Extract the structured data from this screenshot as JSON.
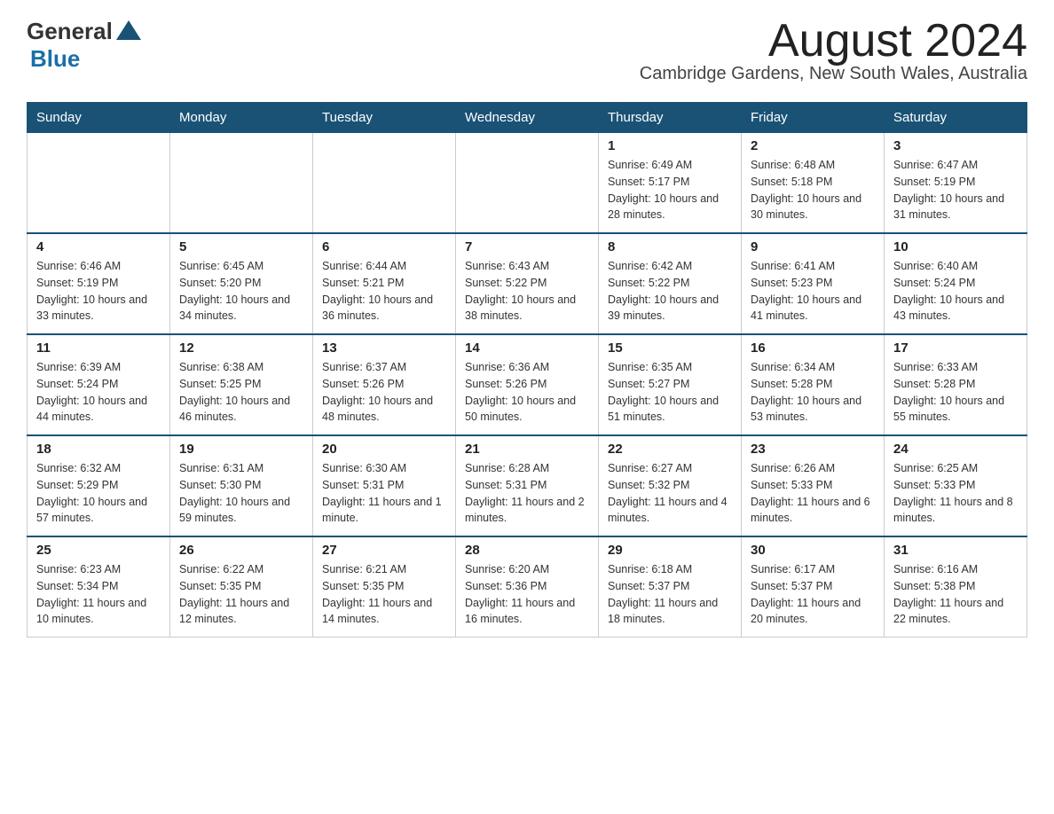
{
  "logo": {
    "general": "General",
    "blue": "Blue"
  },
  "title": "August 2024",
  "subtitle": "Cambridge Gardens, New South Wales, Australia",
  "days_of_week": [
    "Sunday",
    "Monday",
    "Tuesday",
    "Wednesday",
    "Thursday",
    "Friday",
    "Saturday"
  ],
  "weeks": [
    [
      {
        "day": "",
        "info": ""
      },
      {
        "day": "",
        "info": ""
      },
      {
        "day": "",
        "info": ""
      },
      {
        "day": "",
        "info": ""
      },
      {
        "day": "1",
        "info": "Sunrise: 6:49 AM\nSunset: 5:17 PM\nDaylight: 10 hours and 28 minutes."
      },
      {
        "day": "2",
        "info": "Sunrise: 6:48 AM\nSunset: 5:18 PM\nDaylight: 10 hours and 30 minutes."
      },
      {
        "day": "3",
        "info": "Sunrise: 6:47 AM\nSunset: 5:19 PM\nDaylight: 10 hours and 31 minutes."
      }
    ],
    [
      {
        "day": "4",
        "info": "Sunrise: 6:46 AM\nSunset: 5:19 PM\nDaylight: 10 hours and 33 minutes."
      },
      {
        "day": "5",
        "info": "Sunrise: 6:45 AM\nSunset: 5:20 PM\nDaylight: 10 hours and 34 minutes."
      },
      {
        "day": "6",
        "info": "Sunrise: 6:44 AM\nSunset: 5:21 PM\nDaylight: 10 hours and 36 minutes."
      },
      {
        "day": "7",
        "info": "Sunrise: 6:43 AM\nSunset: 5:22 PM\nDaylight: 10 hours and 38 minutes."
      },
      {
        "day": "8",
        "info": "Sunrise: 6:42 AM\nSunset: 5:22 PM\nDaylight: 10 hours and 39 minutes."
      },
      {
        "day": "9",
        "info": "Sunrise: 6:41 AM\nSunset: 5:23 PM\nDaylight: 10 hours and 41 minutes."
      },
      {
        "day": "10",
        "info": "Sunrise: 6:40 AM\nSunset: 5:24 PM\nDaylight: 10 hours and 43 minutes."
      }
    ],
    [
      {
        "day": "11",
        "info": "Sunrise: 6:39 AM\nSunset: 5:24 PM\nDaylight: 10 hours and 44 minutes."
      },
      {
        "day": "12",
        "info": "Sunrise: 6:38 AM\nSunset: 5:25 PM\nDaylight: 10 hours and 46 minutes."
      },
      {
        "day": "13",
        "info": "Sunrise: 6:37 AM\nSunset: 5:26 PM\nDaylight: 10 hours and 48 minutes."
      },
      {
        "day": "14",
        "info": "Sunrise: 6:36 AM\nSunset: 5:26 PM\nDaylight: 10 hours and 50 minutes."
      },
      {
        "day": "15",
        "info": "Sunrise: 6:35 AM\nSunset: 5:27 PM\nDaylight: 10 hours and 51 minutes."
      },
      {
        "day": "16",
        "info": "Sunrise: 6:34 AM\nSunset: 5:28 PM\nDaylight: 10 hours and 53 minutes."
      },
      {
        "day": "17",
        "info": "Sunrise: 6:33 AM\nSunset: 5:28 PM\nDaylight: 10 hours and 55 minutes."
      }
    ],
    [
      {
        "day": "18",
        "info": "Sunrise: 6:32 AM\nSunset: 5:29 PM\nDaylight: 10 hours and 57 minutes."
      },
      {
        "day": "19",
        "info": "Sunrise: 6:31 AM\nSunset: 5:30 PM\nDaylight: 10 hours and 59 minutes."
      },
      {
        "day": "20",
        "info": "Sunrise: 6:30 AM\nSunset: 5:31 PM\nDaylight: 11 hours and 1 minute."
      },
      {
        "day": "21",
        "info": "Sunrise: 6:28 AM\nSunset: 5:31 PM\nDaylight: 11 hours and 2 minutes."
      },
      {
        "day": "22",
        "info": "Sunrise: 6:27 AM\nSunset: 5:32 PM\nDaylight: 11 hours and 4 minutes."
      },
      {
        "day": "23",
        "info": "Sunrise: 6:26 AM\nSunset: 5:33 PM\nDaylight: 11 hours and 6 minutes."
      },
      {
        "day": "24",
        "info": "Sunrise: 6:25 AM\nSunset: 5:33 PM\nDaylight: 11 hours and 8 minutes."
      }
    ],
    [
      {
        "day": "25",
        "info": "Sunrise: 6:23 AM\nSunset: 5:34 PM\nDaylight: 11 hours and 10 minutes."
      },
      {
        "day": "26",
        "info": "Sunrise: 6:22 AM\nSunset: 5:35 PM\nDaylight: 11 hours and 12 minutes."
      },
      {
        "day": "27",
        "info": "Sunrise: 6:21 AM\nSunset: 5:35 PM\nDaylight: 11 hours and 14 minutes."
      },
      {
        "day": "28",
        "info": "Sunrise: 6:20 AM\nSunset: 5:36 PM\nDaylight: 11 hours and 16 minutes."
      },
      {
        "day": "29",
        "info": "Sunrise: 6:18 AM\nSunset: 5:37 PM\nDaylight: 11 hours and 18 minutes."
      },
      {
        "day": "30",
        "info": "Sunrise: 6:17 AM\nSunset: 5:37 PM\nDaylight: 11 hours and 20 minutes."
      },
      {
        "day": "31",
        "info": "Sunrise: 6:16 AM\nSunset: 5:38 PM\nDaylight: 11 hours and 22 minutes."
      }
    ]
  ]
}
